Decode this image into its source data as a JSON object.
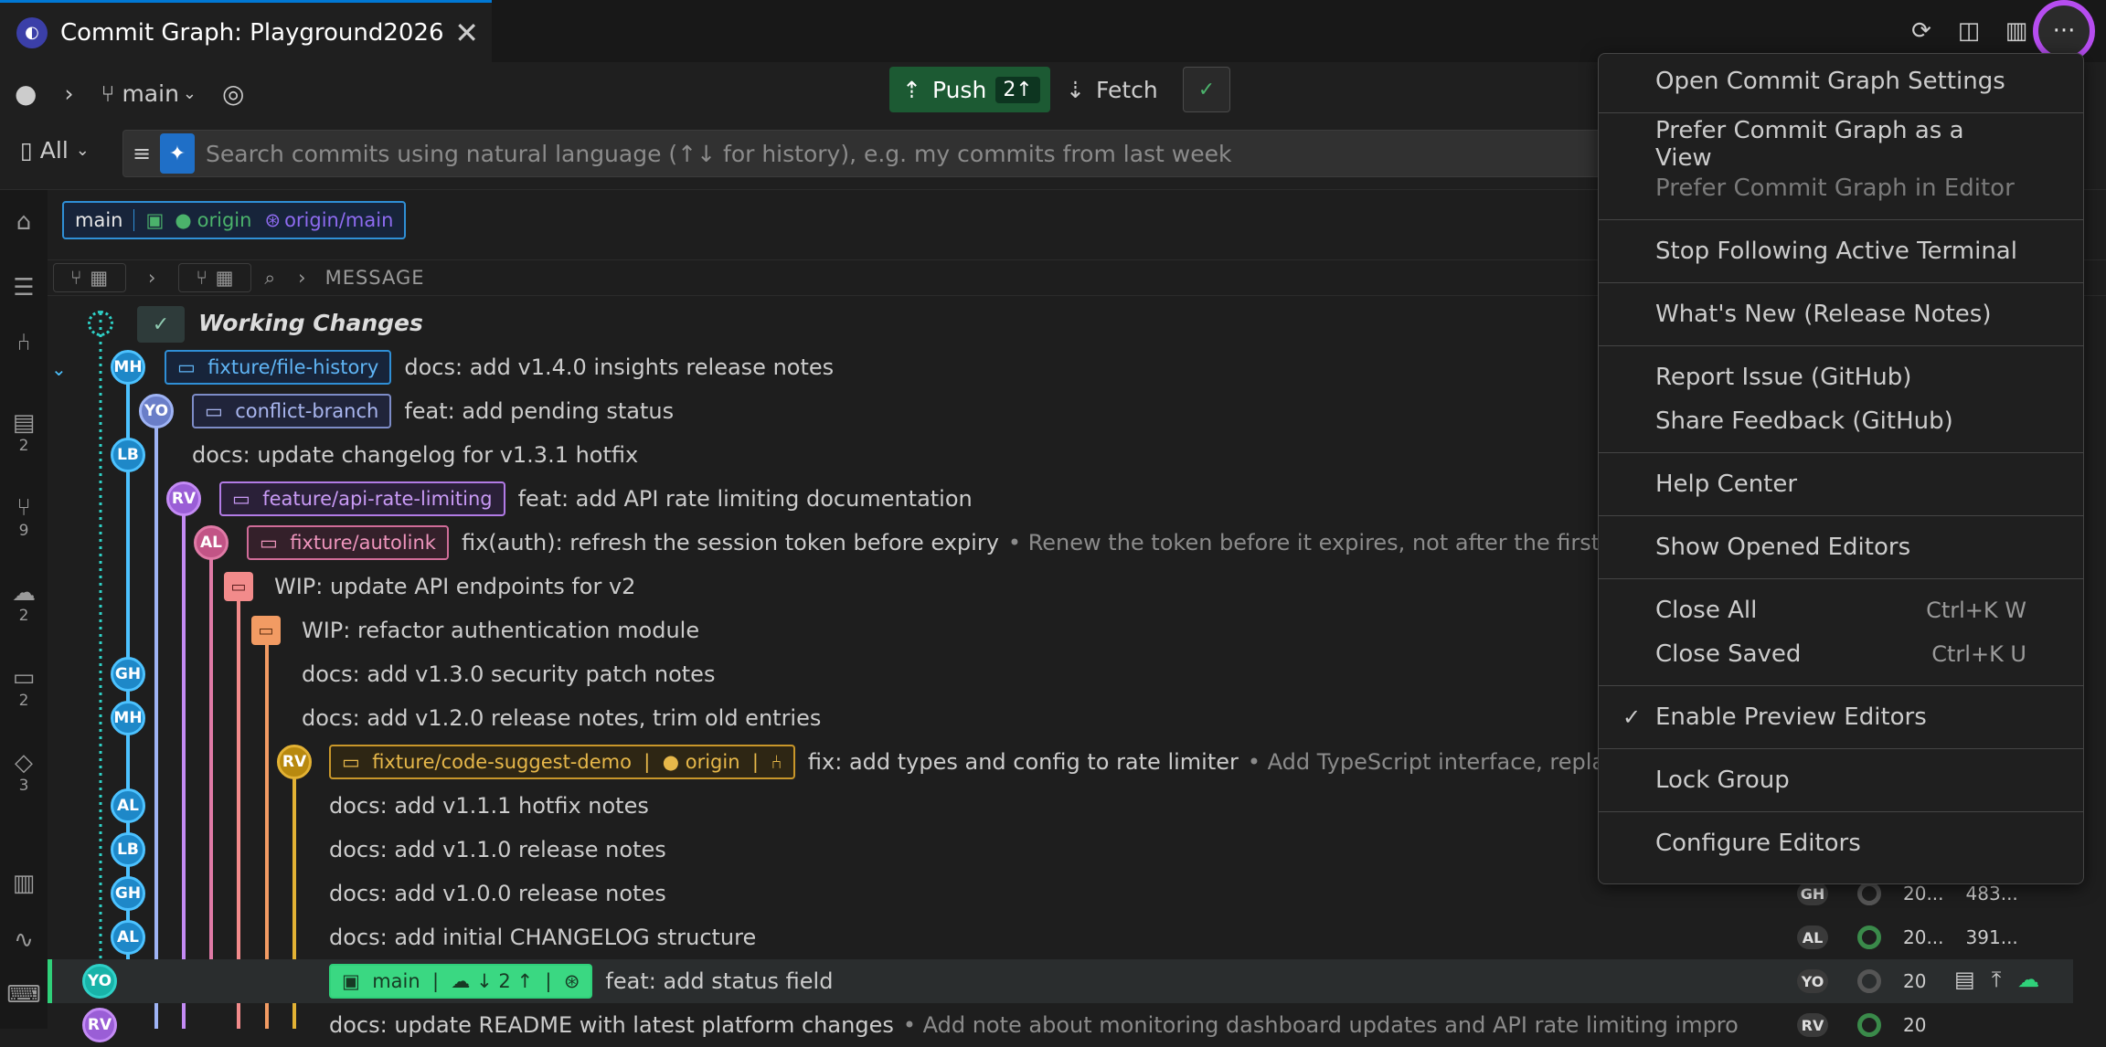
{
  "tab": {
    "title": "Commit Graph: Playground2026",
    "close": "✕"
  },
  "toolbar": {
    "branch": "main",
    "push_label": "Push",
    "push_count": "2↑",
    "fetch_label": "Fetch"
  },
  "search": {
    "scope": "All",
    "placeholder": "Search commits using natural language (↑↓ for history), e.g. my commits from last week"
  },
  "activity": {
    "counts": [
      "2",
      "9",
      "2",
      "2",
      "3"
    ]
  },
  "branch_summary": {
    "local": "main",
    "remote1": "origin",
    "remote2": "origin/main"
  },
  "column_header": "MESSAGE",
  "working_changes": "Working Changes",
  "rows": [
    {
      "avatar": "MH",
      "tag": "fixture/file-history",
      "msg": "docs: add v1.4.0 insights release notes",
      "desc": ""
    },
    {
      "avatar": "YO",
      "tag": "conflict-branch",
      "msg": "feat: add pending status",
      "desc": ""
    },
    {
      "avatar": "LB",
      "tag": "",
      "msg": "docs: update changelog for v1.3.1 hotfix",
      "desc": ""
    },
    {
      "avatar": "RV",
      "tag": "feature/api-rate-limiting",
      "msg": "feat: add API rate limiting documentation",
      "desc": ""
    },
    {
      "avatar": "AL",
      "tag": "fixture/autolink",
      "msg": "fix(auth): refresh the session token before expiry",
      "desc": "• Renew the token before it expires, not after the first"
    },
    {
      "avatar": "",
      "tag": "",
      "msg": "WIP: update API endpoints for v2",
      "desc": ""
    },
    {
      "avatar": "",
      "tag": "",
      "msg": "WIP: refactor authentication module",
      "desc": ""
    },
    {
      "avatar": "GH",
      "tag": "",
      "msg": "docs: add v1.3.0 security patch notes",
      "desc": ""
    },
    {
      "avatar": "MH",
      "tag": "",
      "msg": "docs: add v1.2.0 release notes, trim old entries",
      "desc": ""
    },
    {
      "avatar": "RV",
      "tag": "fixture/code-suggest-demo",
      "tag_remote": "origin",
      "msg": "fix: add types and config to rate limiter",
      "desc": "• Add TypeScript interface, replac"
    },
    {
      "avatar": "AL",
      "tag": "",
      "msg": "docs: add v1.1.1 hotfix notes",
      "desc": ""
    },
    {
      "avatar": "LB",
      "tag": "",
      "msg": "docs: add v1.1.0 release notes",
      "desc": ""
    },
    {
      "avatar": "GH",
      "tag": "",
      "msg": "docs: add v1.0.0 release notes",
      "desc": ""
    },
    {
      "avatar": "AL",
      "tag": "",
      "msg": "docs: add initial CHANGELOG structure",
      "desc": ""
    },
    {
      "avatar": "YO",
      "tag": "main",
      "tag_counts": "↓ 2 ↑",
      "msg": "feat: add status field",
      "desc": ""
    },
    {
      "avatar": "RV",
      "tag": "",
      "msg": "docs: update README with latest platform changes",
      "desc": "• Add note about monitoring dashboard updates and API rate limiting impro"
    }
  ],
  "right_rows": [
    {
      "avatar": "GH",
      "date": "20...",
      "sha": "483..."
    },
    {
      "avatar": "AL",
      "date": "20...",
      "sha": "391..."
    },
    {
      "avatar": "YO",
      "date": "20",
      "sha": ""
    },
    {
      "avatar": "RV",
      "date": "20",
      "sha": ""
    }
  ],
  "menu": {
    "items": [
      {
        "label": "Open Commit Graph Settings"
      },
      {
        "label": "Prefer Commit Graph as a View"
      },
      {
        "label": "Prefer Commit Graph in Editor"
      },
      {
        "label": "Stop Following Active Terminal"
      },
      {
        "label": "What's New (Release Notes)"
      },
      {
        "label": "Report Issue (GitHub)"
      },
      {
        "label": "Share Feedback (GitHub)"
      },
      {
        "label": "Help Center"
      },
      {
        "label": "Show Opened Editors"
      },
      {
        "label": "Close All",
        "shortcut": "Ctrl+K W"
      },
      {
        "label": "Close Saved",
        "shortcut": "Ctrl+K U"
      },
      {
        "label": "Enable Preview Editors"
      },
      {
        "label": "Lock Group"
      },
      {
        "label": "Configure Editors"
      }
    ]
  },
  "colors": {
    "accent": "#0078d4",
    "push_bg": "#1c5a33",
    "highlight_ring": "#b64df0"
  }
}
